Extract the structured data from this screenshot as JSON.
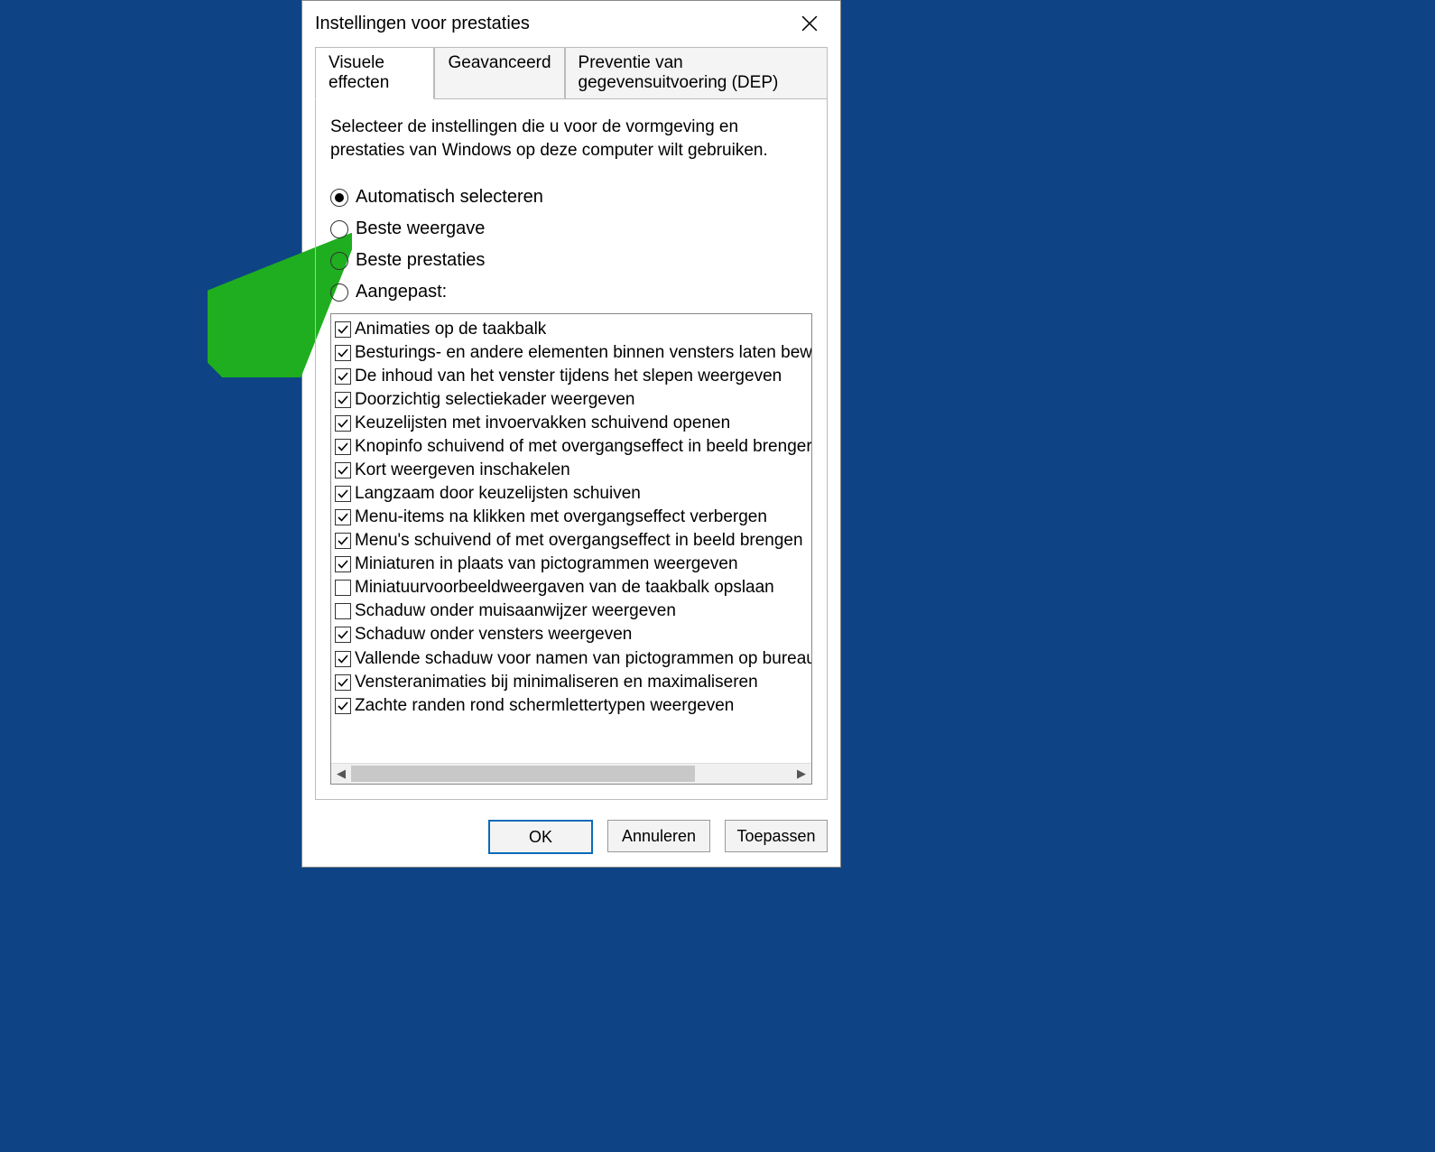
{
  "window": {
    "title": "Instellingen voor prestaties"
  },
  "tabs": [
    {
      "label": "Visuele effecten",
      "active": true
    },
    {
      "label": "Geavanceerd",
      "active": false
    },
    {
      "label": "Preventie van gegevensuitvoering (DEP)",
      "active": false
    }
  ],
  "description": "Selecteer de instellingen die u voor de vormgeving en prestaties van Windows op deze computer wilt gebruiken.",
  "radios": [
    {
      "label": "Automatisch selecteren",
      "selected": true
    },
    {
      "label": "Beste weergave",
      "selected": false
    },
    {
      "label": "Beste prestaties",
      "selected": false
    },
    {
      "label": "Aangepast:",
      "selected": false
    }
  ],
  "options": [
    {
      "label": "Animaties op de taakbalk",
      "checked": true
    },
    {
      "label": "Besturings- en andere elementen binnen vensters laten bewe",
      "checked": true
    },
    {
      "label": "De inhoud van het venster tijdens het slepen weergeven",
      "checked": true
    },
    {
      "label": "Doorzichtig selectiekader weergeven",
      "checked": true
    },
    {
      "label": "Keuzelijsten met invoervakken schuivend openen",
      "checked": true
    },
    {
      "label": "Knopinfo schuivend of met overgangseffect in beeld brenger",
      "checked": true
    },
    {
      "label": "Kort weergeven inschakelen",
      "checked": true
    },
    {
      "label": "Langzaam door keuzelijsten schuiven",
      "checked": true
    },
    {
      "label": "Menu-items na klikken met overgangseffect verbergen",
      "checked": true
    },
    {
      "label": "Menu's schuivend of met overgangseffect in beeld brengen",
      "checked": true
    },
    {
      "label": "Miniaturen in plaats van pictogrammen weergeven",
      "checked": true
    },
    {
      "label": "Miniatuurvoorbeeldweergaven van de taakbalk opslaan",
      "checked": false
    },
    {
      "label": "Schaduw onder muisaanwijzer weergeven",
      "checked": false
    },
    {
      "label": "Schaduw onder vensters weergeven",
      "checked": true
    },
    {
      "label": "Vallende schaduw voor namen van pictogrammen op bureau",
      "checked": true
    },
    {
      "label": "Vensteranimaties bij minimaliseren en maximaliseren",
      "checked": true
    },
    {
      "label": "Zachte randen rond schermlettertypen weergeven",
      "checked": true
    }
  ],
  "buttons": {
    "ok": "OK",
    "cancel": "Annuleren",
    "apply": "Toepassen"
  }
}
